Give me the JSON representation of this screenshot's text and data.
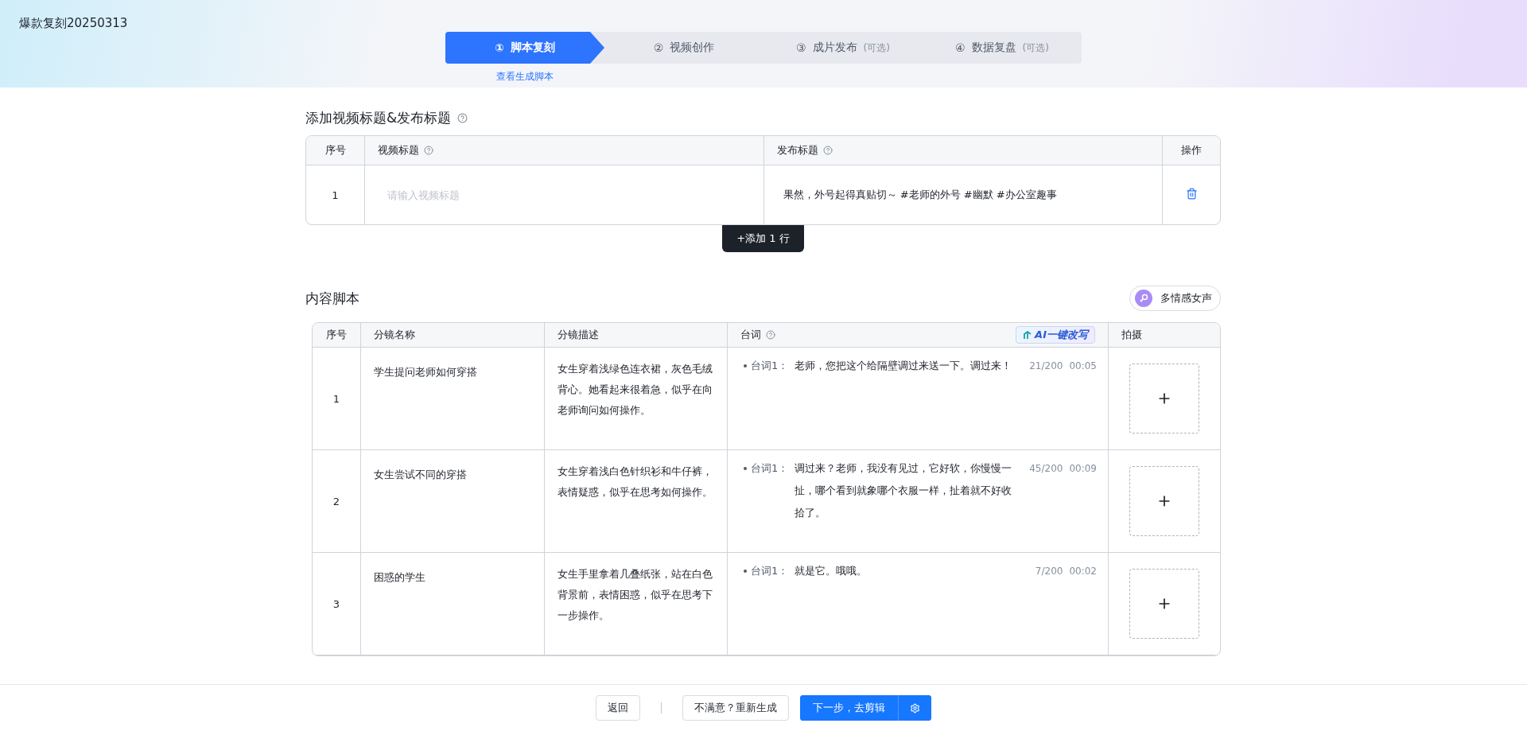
{
  "project_title": "爆款复刻20250313",
  "steps": [
    {
      "number": "①",
      "label": "脚本复刻",
      "selected": true
    },
    {
      "number": "②",
      "label": "视频创作",
      "selected": false
    },
    {
      "number": "③",
      "label": "成片发布",
      "note": "(可选)",
      "selected": false
    },
    {
      "number": "④",
      "label": "数据复盘",
      "note": "(可选)",
      "selected": false
    }
  ],
  "step_link": "查看生成脚本",
  "titles_section": {
    "heading": "添加视频标题&发布标题",
    "columns": [
      {
        "label": "序号",
        "help": false
      },
      {
        "label": "视频标题",
        "help": true
      },
      {
        "label": "发布标题",
        "help": true
      },
      {
        "label": "操作",
        "help": false
      }
    ],
    "rows": [
      {
        "index": "1",
        "video_title_placeholder": "请输入视频标题",
        "publish_title": "果然，外号起得真贴切～ #老师的外号 #幽默 #办公室趣事"
      }
    ],
    "add_row_button": "+添加 1 行"
  },
  "script_section": {
    "heading": "内容脚本",
    "voice_button": "多情感女声",
    "ai_button": "AI一键改写",
    "columns": [
      {
        "label": "序号",
        "help": false
      },
      {
        "label": "分镜名称",
        "help": false
      },
      {
        "label": "分镜描述",
        "help": false
      },
      {
        "label": "台词",
        "help": true
      },
      {
        "label": "拍摄",
        "help": false
      }
    ],
    "rows": [
      {
        "index": "1",
        "shot_name": "学生提问老师如何穿搭",
        "description": "女生穿着浅绿色连衣裙，灰色毛绒背心。她看起来很着急，似乎在向老师询问如何操作。",
        "line_label": "台词1：",
        "line": "老师，您把这个给隔壁调过来送一下。调过来！",
        "count": "21/200",
        "duration": "00:05"
      },
      {
        "index": "2",
        "shot_name": "女生尝试不同的穿搭",
        "description": "女生穿着浅白色针织衫和牛仔裤，表情疑惑，似乎在思考如何操作。",
        "line_label": "台词1：",
        "line": "调过来？老师，我没有见过，它好软，你慢慢一扯，哪个看到就象哪个衣服一样，扯着就不好收拾了。",
        "count": "45/200",
        "duration": "00:09"
      },
      {
        "index": "3",
        "shot_name": "困惑的学生",
        "description": "女生手里拿着几叠纸张，站在白色背景前，表情困惑，似乎在思考下一步操作。",
        "line_label": "台词1：",
        "line": "就是它。哦哦。",
        "count": "7/200",
        "duration": "00:02"
      }
    ]
  },
  "footer": {
    "back_button": "返回",
    "regenerate_button": "不满意？重新生成",
    "next_button": "下一步，去剪辑"
  }
}
